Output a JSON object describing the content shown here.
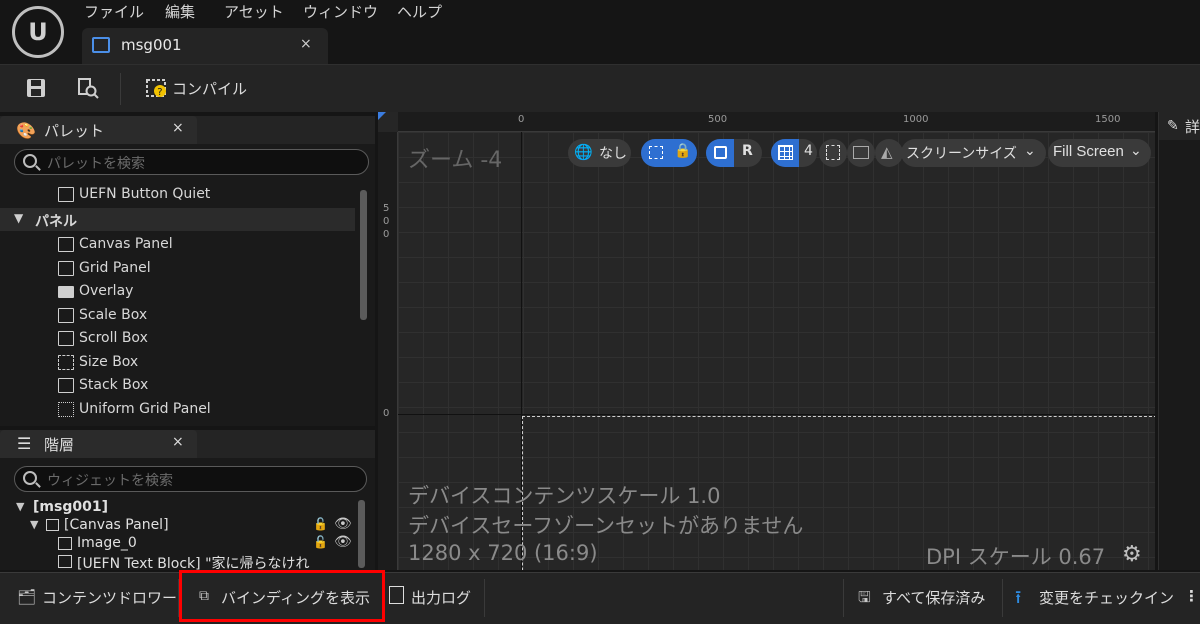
{
  "menu": {
    "items": [
      "ファイル",
      "編集",
      "アセット",
      "ウィンドウ",
      "ヘルプ"
    ]
  },
  "document_tab": {
    "label": "msg001",
    "close": "×"
  },
  "toolbar": {
    "compile_label": "コンパイル"
  },
  "palette": {
    "title": "パレット",
    "close": "×",
    "search_placeholder": "パレットを検索",
    "items": [
      {
        "label": "UEFN Button Quiet",
        "icon": "button-icon"
      },
      {
        "label": "パネル",
        "category": true
      },
      {
        "label": "Canvas Panel",
        "icon": "canvas-panel-icon"
      },
      {
        "label": "Grid Panel",
        "icon": "grid-panel-icon"
      },
      {
        "label": "Overlay",
        "icon": "overlay-icon"
      },
      {
        "label": "Scale Box",
        "icon": "scale-box-icon"
      },
      {
        "label": "Scroll Box",
        "icon": "scroll-box-icon"
      },
      {
        "label": "Size Box",
        "icon": "size-box-icon"
      },
      {
        "label": "Stack Box",
        "icon": "stack-box-icon"
      },
      {
        "label": "Uniform Grid Panel",
        "icon": "uniform-grid-icon"
      }
    ]
  },
  "hierarchy": {
    "title": "階層",
    "close": "×",
    "search_placeholder": "ウィジェットを検索",
    "items": [
      {
        "label": "[msg001]"
      },
      {
        "label": "[Canvas Panel]"
      },
      {
        "label": "Image_0"
      },
      {
        "label": "[UEFN Text Block] \"家に帰らなけれ"
      }
    ]
  },
  "viewport": {
    "zoom_label": "ズーム -4",
    "ruler_top": [
      "0",
      "500",
      "1000",
      "1500"
    ],
    "ruler_left": [
      "5",
      "0",
      "0",
      "0"
    ],
    "none_label": "なし",
    "r_label": "R",
    "grid_value": "4",
    "screen_size_label": "スクリーンサイズ",
    "fill_screen_label": "Fill Screen",
    "device_content_scale": "デバイスコンテンツスケール 1.0",
    "safe_zone_message": "デバイスセーフゾーンセットがありません",
    "resolution": "1280 x 720 (16:9)",
    "dpi_scale": "DPI スケール 0.67"
  },
  "details": {
    "title": "詳"
  },
  "bottom_bar": {
    "content_drawer": "コンテンツドロワー",
    "show_bindings": "バインディングを表示",
    "output_log": "出力ログ",
    "all_saved": "すべて保存済み",
    "check_in": "変更をチェックイン",
    "more": "⋮"
  },
  "colors": {
    "accent_blue": "#2e6fd1",
    "highlight_red": "#ff0000"
  }
}
